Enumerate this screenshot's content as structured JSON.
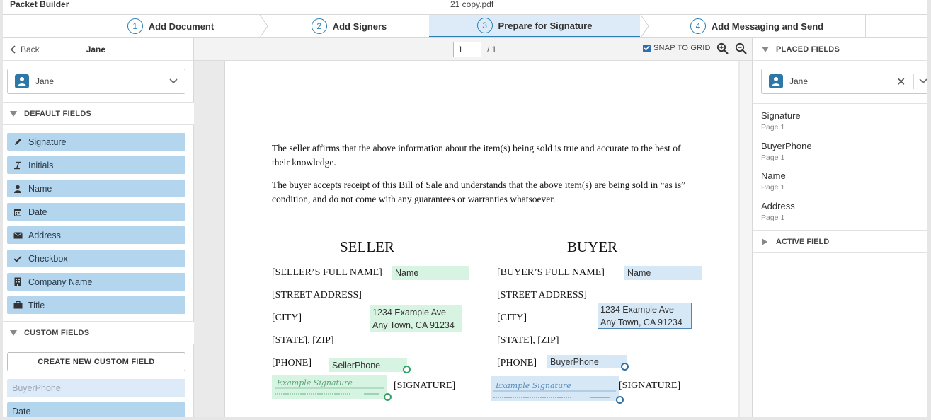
{
  "titlebar": {
    "app_name": "Packet Builder",
    "file_name": "21 copy.pdf"
  },
  "steps": [
    {
      "num": "1",
      "label": "Add Document"
    },
    {
      "num": "2",
      "label": "Add Signers"
    },
    {
      "num": "3",
      "label": "Prepare for Signature"
    },
    {
      "num": "4",
      "label": "Add Messaging and Send"
    }
  ],
  "active_step": 3,
  "left": {
    "back_label": "Back",
    "signer_name": "Jane",
    "selected_signer": "Jane",
    "default_fields_title": "DEFAULT FIELDS",
    "default_fields": [
      {
        "label": "Signature",
        "icon": "pen-icon"
      },
      {
        "label": "Initials",
        "icon": "italic-icon"
      },
      {
        "label": "Name",
        "icon": "person-icon"
      },
      {
        "label": "Date",
        "icon": "calendar-icon"
      },
      {
        "label": "Address",
        "icon": "envelope-icon"
      },
      {
        "label": "Checkbox",
        "icon": "check-icon"
      },
      {
        "label": "Company Name",
        "icon": "building-icon"
      },
      {
        "label": "Title",
        "icon": "briefcase-icon"
      }
    ],
    "custom_fields_title": "CUSTOM FIELDS",
    "create_button": "CREATE NEW CUSTOM FIELD",
    "custom_fields": [
      {
        "label": "BuyerPhone",
        "state": "disabled"
      },
      {
        "label": "Date",
        "state": "active"
      }
    ]
  },
  "viewer": {
    "page_current": "1",
    "page_total": "/ 1",
    "snap_to_grid_label": "SNAP TO GRID",
    "snap_to_grid": true,
    "zoom_in_icon": "zoom-in-icon",
    "zoom_out_icon": "zoom-out-icon"
  },
  "document": {
    "para1": "The seller affirms that the above information about the item(s) being sold is true and accurate to the best of their knowledge.",
    "para2": "The buyer accepts receipt of this Bill of Sale and understands that the above item(s) are being sold in “as is” condition, and do not come with any guarantees or warranties whatsoever.",
    "seller": {
      "heading": "SELLER",
      "full_name_label": "[SELLER’S FULL NAME]",
      "street_label": "[STREET ADDRESS]",
      "city_label": "[CITY]",
      "state_label": "[STATE], [ZIP]",
      "phone_label": "[PHONE]",
      "signature_label": "[SIGNATURE]",
      "name_field": "Name",
      "address_line1": "1234 Example Ave",
      "address_line2": "Any Town, CA 91234",
      "phone_field": "SellerPhone",
      "signature_sample": "Example Signature"
    },
    "buyer": {
      "heading": "BUYER",
      "full_name_label": "[BUYER’S FULL NAME]",
      "street_label": "[STREET ADDRESS]",
      "city_label": "[CITY]",
      "state_label": "[STATE], [ZIP]",
      "phone_label": "[PHONE]",
      "signature_label": "[SIGNATURE]",
      "name_field": "Name",
      "address_line1": "1234 Example Ave",
      "address_line2": "Any Town, CA 91234",
      "phone_field": "BuyerPhone",
      "signature_sample": "Example Signature"
    }
  },
  "right": {
    "placed_title": "PLACED FIELDS",
    "selected_signer": "Jane",
    "placed_fields": [
      {
        "name": "Signature",
        "page": "Page 1"
      },
      {
        "name": "BuyerPhone",
        "page": "Page 1"
      },
      {
        "name": "Name",
        "page": "Page 1"
      },
      {
        "name": "Address",
        "page": "Page 1"
      }
    ],
    "active_title": "ACTIVE FIELD"
  },
  "colors": {
    "accent": "#2b7fb3",
    "field_blue": "#b3d5ee",
    "seller_green": "#d7f3e1",
    "buyer_blue": "#d6e7f6"
  }
}
